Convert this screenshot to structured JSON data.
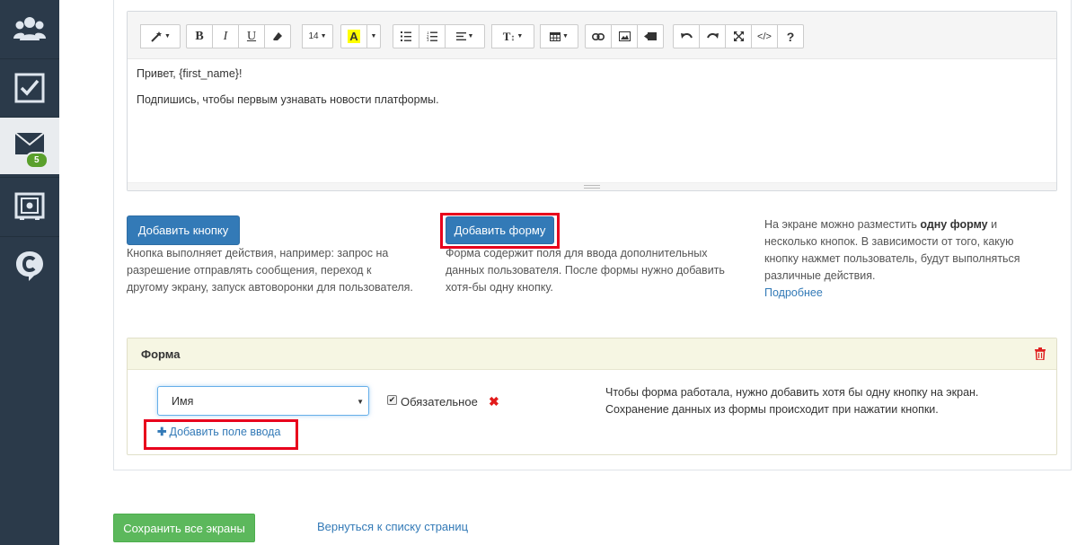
{
  "sidebar": {
    "items": [
      {
        "icon": "users-icon"
      },
      {
        "icon": "checkbox-icon"
      },
      {
        "icon": "mail-icon",
        "badge": "5"
      },
      {
        "icon": "settings-screen-icon"
      },
      {
        "icon": "chat-c-icon"
      }
    ]
  },
  "editor": {
    "toolbar": {
      "font_size": "14",
      "text_style": "T",
      "help": "?",
      "code": "</>"
    },
    "body": {
      "line1": "Привет, {first_name}!",
      "line2": "Подпишись, чтобы первым узнавать новости платформы."
    }
  },
  "actions": {
    "add_button_label": "Добавить кнопку",
    "add_button_desc": "Кнопка выполняет действия, например: запрос на разрешение отправлять сообщения, переход к другому экрану, запуск автоворонки для пользователя.",
    "add_form_label": "Добавить форму",
    "add_form_desc": "Форма содержит поля для ввода дополнительных данных пользователя. После формы нужно добавить хотя-бы одну кнопку.",
    "info_prefix": "На экране можно разместить ",
    "info_bold": "одну форму",
    "info_suffix": " и несколько кнопок. В зависимости от того, какую кнопку нажмет пользователь, будут выполняться различные действия.",
    "more_link": "Подробнее"
  },
  "form_panel": {
    "title": "Форма",
    "field_select_value": "Имя",
    "required_label": "Обязательное",
    "required_checked": true,
    "note_line1": "Чтобы форма работала, нужно добавить хотя бы одну кнопку на экран.",
    "note_line2": "Сохранение данных из формы происходит при нажатии кнопки.",
    "add_field_label": "Добавить поле ввода"
  },
  "footer": {
    "save_label": "Сохранить все экраны",
    "back_label": "Вернуться к списку страниц"
  },
  "colors": {
    "sidebar_bg": "#2b3a4a",
    "primary": "#337ab7",
    "success": "#5cb85c",
    "highlight_red": "#e8001c",
    "badge_green": "#5aa02c"
  }
}
